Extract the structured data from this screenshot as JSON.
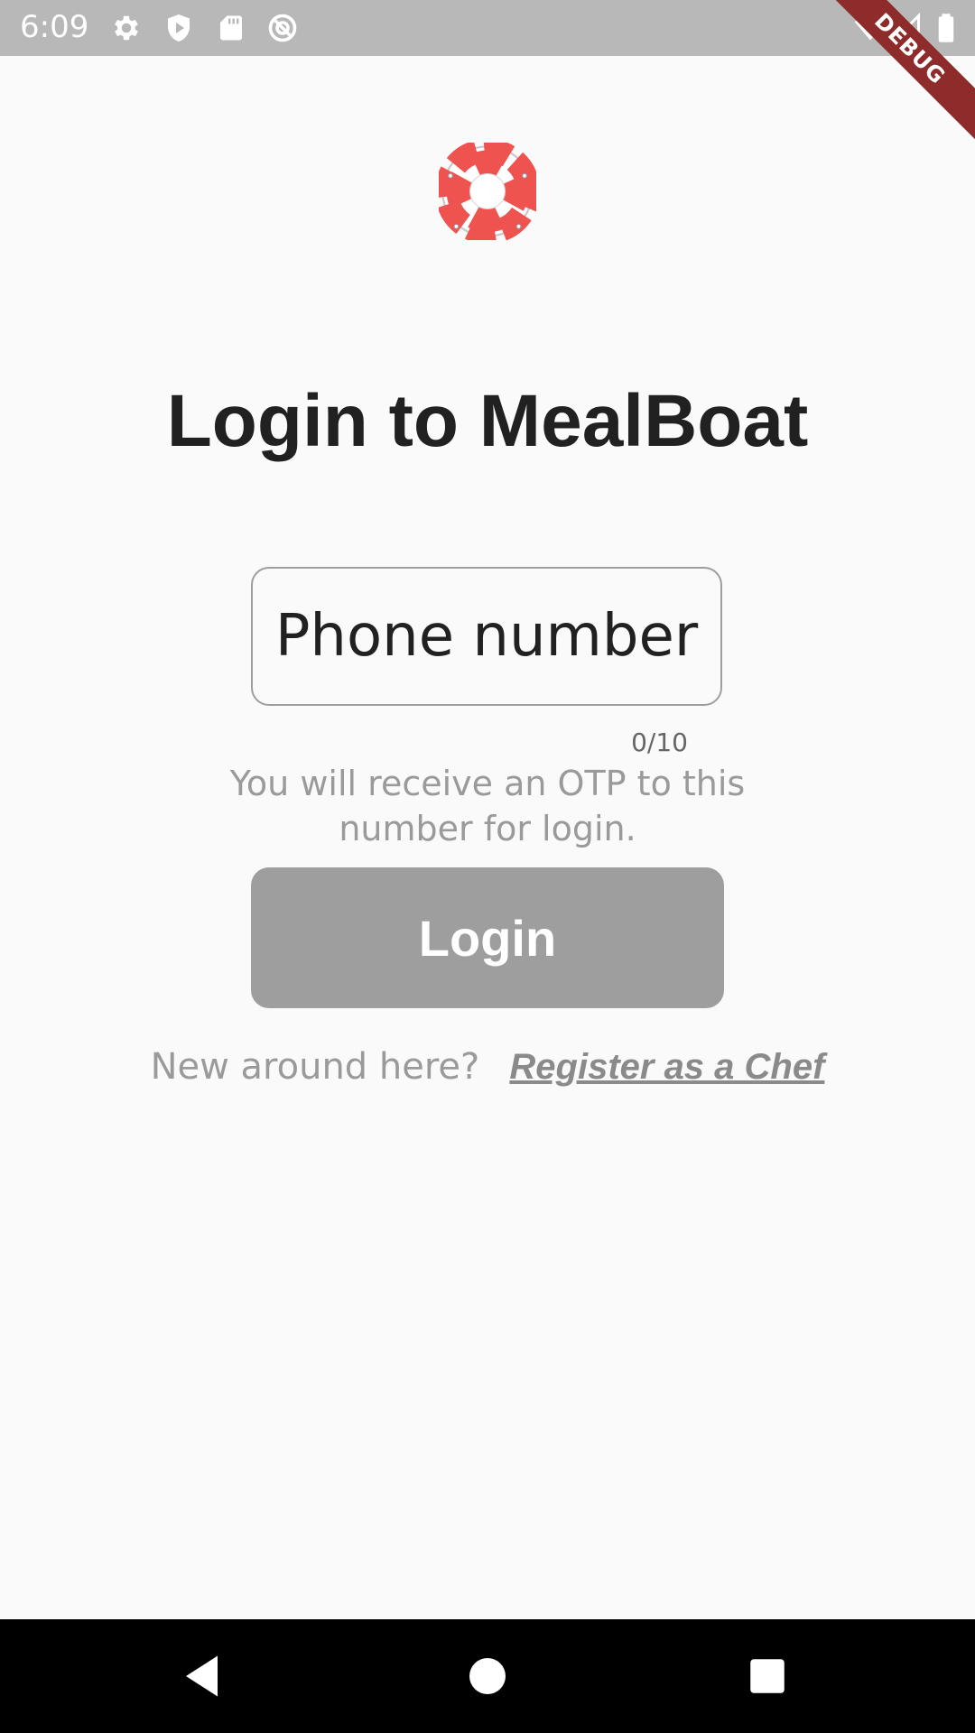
{
  "status_bar": {
    "time": "6:09",
    "left_icons": [
      "settings-icon",
      "shield-icon",
      "sd-card-icon",
      "no-disturb-icon"
    ],
    "right_icons": [
      "wifi-icon",
      "signal-icon",
      "battery-icon"
    ]
  },
  "debug_banner": {
    "label": "DEBUG",
    "color": "#8e2b2b"
  },
  "logo": {
    "icon": "lifebuoy-icon",
    "color": "#ef5350"
  },
  "title": "Login to MealBoat",
  "phone_field": {
    "placeholder": "Phone number",
    "value": "",
    "counter": "0/10"
  },
  "helper_text": "You will receive an OTP to this number for login.",
  "login_button": {
    "label": "Login",
    "color": "#9e9e9e"
  },
  "register": {
    "prompt": "New around here?",
    "link_label": "Register as a Chef"
  },
  "nav_bar": {
    "buttons": [
      "back-icon",
      "home-icon",
      "recents-icon"
    ]
  }
}
